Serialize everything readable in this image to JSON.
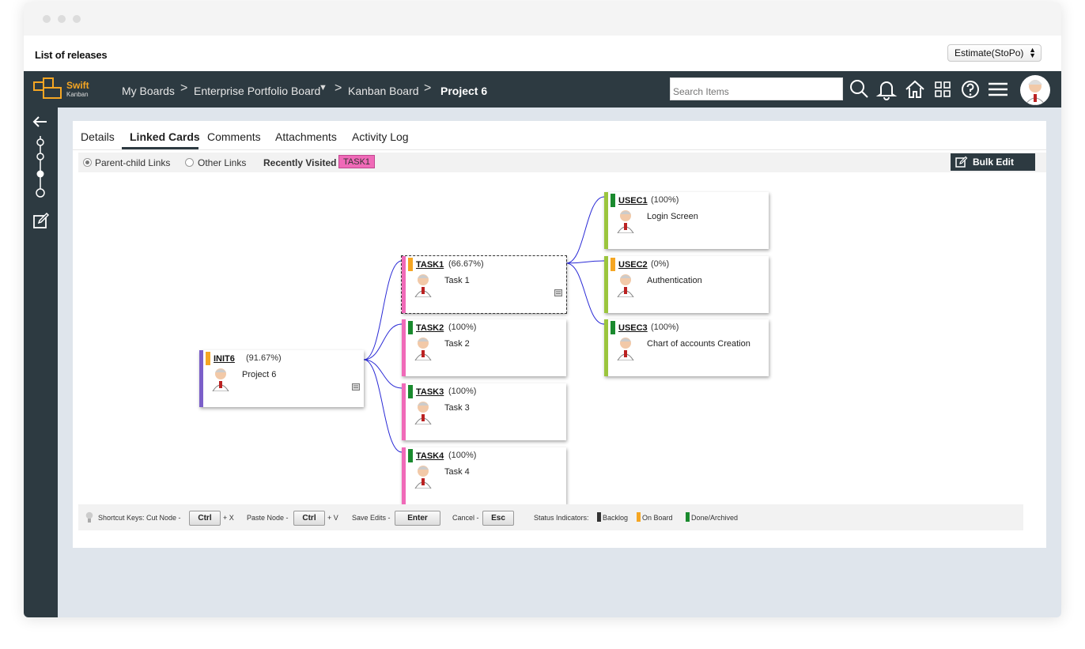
{
  "top": {
    "title": "List of releases",
    "estimate": "Estimate(StoPo)"
  },
  "logo": {
    "line1": "Swift",
    "line2": "Kanban"
  },
  "breadcrumb": [
    "My Boards",
    "Enterprise Portfolio Board",
    "Kanban Board",
    "Project 6"
  ],
  "search": {
    "placeholder": "Search Items"
  },
  "tabs": [
    "Details",
    "Linked Cards",
    "Comments",
    "Attachments",
    "Activity Log"
  ],
  "options": {
    "parent_child": "Parent-child Links",
    "other": "Other Links",
    "recent_label": "Recently Visited :",
    "recent_tag": "TASK1",
    "bulk_edit": "Bulk Edit"
  },
  "cards": [
    {
      "id": "INIT6",
      "pct": "(91.67%)",
      "title": "Project 6",
      "status": "On Board",
      "edge": "#7b5fc9"
    },
    {
      "id": "TASK1",
      "pct": "(66.67%)",
      "title": "Task 1",
      "status": "On Board",
      "edge": "#f06ab8"
    },
    {
      "id": "TASK2",
      "pct": "(100%)",
      "title": "Task 2",
      "status": "Done/Archived",
      "edge": "#f06ab8"
    },
    {
      "id": "TASK3",
      "pct": "(100%)",
      "title": "Task 3",
      "status": "Done/Archived",
      "edge": "#f06ab8"
    },
    {
      "id": "TASK4",
      "pct": "(100%)",
      "title": "Task 4",
      "status": "Done/Archived",
      "edge": "#f06ab8"
    },
    {
      "id": "USEC1",
      "pct": "(100%)",
      "title": "Login Screen",
      "status": "Done/Archived",
      "edge": "#9bc53d"
    },
    {
      "id": "USEC2",
      "pct": "(0%)",
      "title": "Authentication",
      "status": "On Board",
      "edge": "#9bc53d"
    },
    {
      "id": "USEC3",
      "pct": "(100%)",
      "title": "Chart of accounts Creation",
      "status": "Done/Archived",
      "edge": "#9bc53d"
    }
  ],
  "shortcuts": {
    "label": "Shortcut Keys: Cut Node -",
    "ctrl": "Ctrl",
    "x": "+ X",
    "paste": "Paste Node -",
    "v": "+ V",
    "save": "Save Edits -",
    "enter": "Enter",
    "cancel": "Cancel -",
    "esc": "Esc",
    "status_label": "Status Indicators:",
    "backlog": "Backlog",
    "onboard": "On Board",
    "done": "Done/Archived"
  },
  "colors": {
    "backlog": "#333333",
    "onboard": "#f5a623",
    "done": "#1a8a2e",
    "navbar": "#2d3a41",
    "link_line": "#2b2bd6"
  }
}
